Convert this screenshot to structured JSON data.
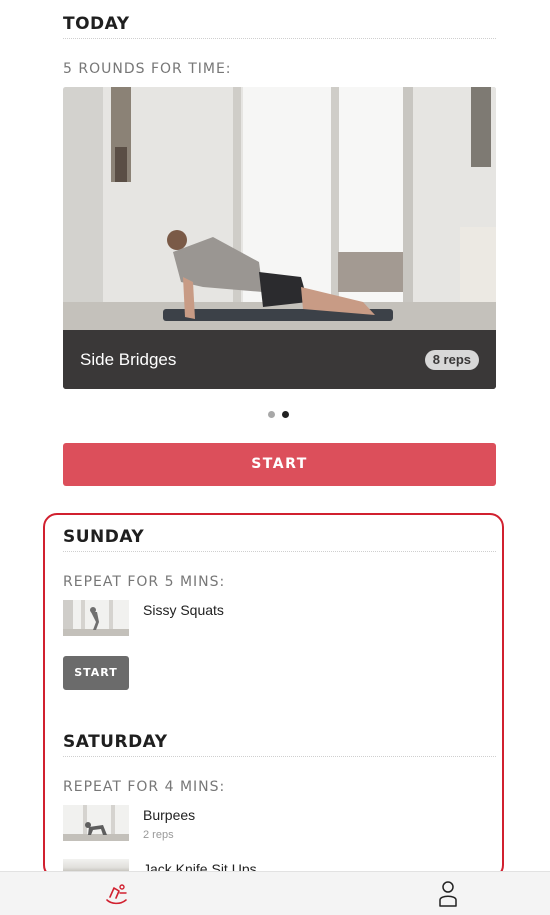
{
  "today": {
    "heading": "TODAY",
    "subheading": "5 ROUNDS FOR TIME:",
    "exercise": {
      "name": "Side Bridges",
      "reps": "8 reps"
    },
    "carousel": {
      "count": 2,
      "active": 2
    },
    "start_label": "START"
  },
  "days": [
    {
      "heading": "SUNDAY",
      "subheading": "REPEAT FOR 5 MINS:",
      "exercises": [
        {
          "name": "Sissy Squats"
        }
      ],
      "start_label": "START"
    },
    {
      "heading": "SATURDAY",
      "subheading": "REPEAT FOR 4 MINS:",
      "exercises": [
        {
          "name": "Burpees",
          "reps": "2 reps"
        },
        {
          "name": "Jack Knife Sit Ups"
        }
      ]
    }
  ],
  "nav": {
    "workouts_icon": "workout-icon",
    "profile_icon": "profile-icon"
  },
  "colors": {
    "accent": "#dc4f5b",
    "highlight": "#d1202f",
    "caption_bg": "#3a3838",
    "small_button": "#6b6b6b"
  }
}
